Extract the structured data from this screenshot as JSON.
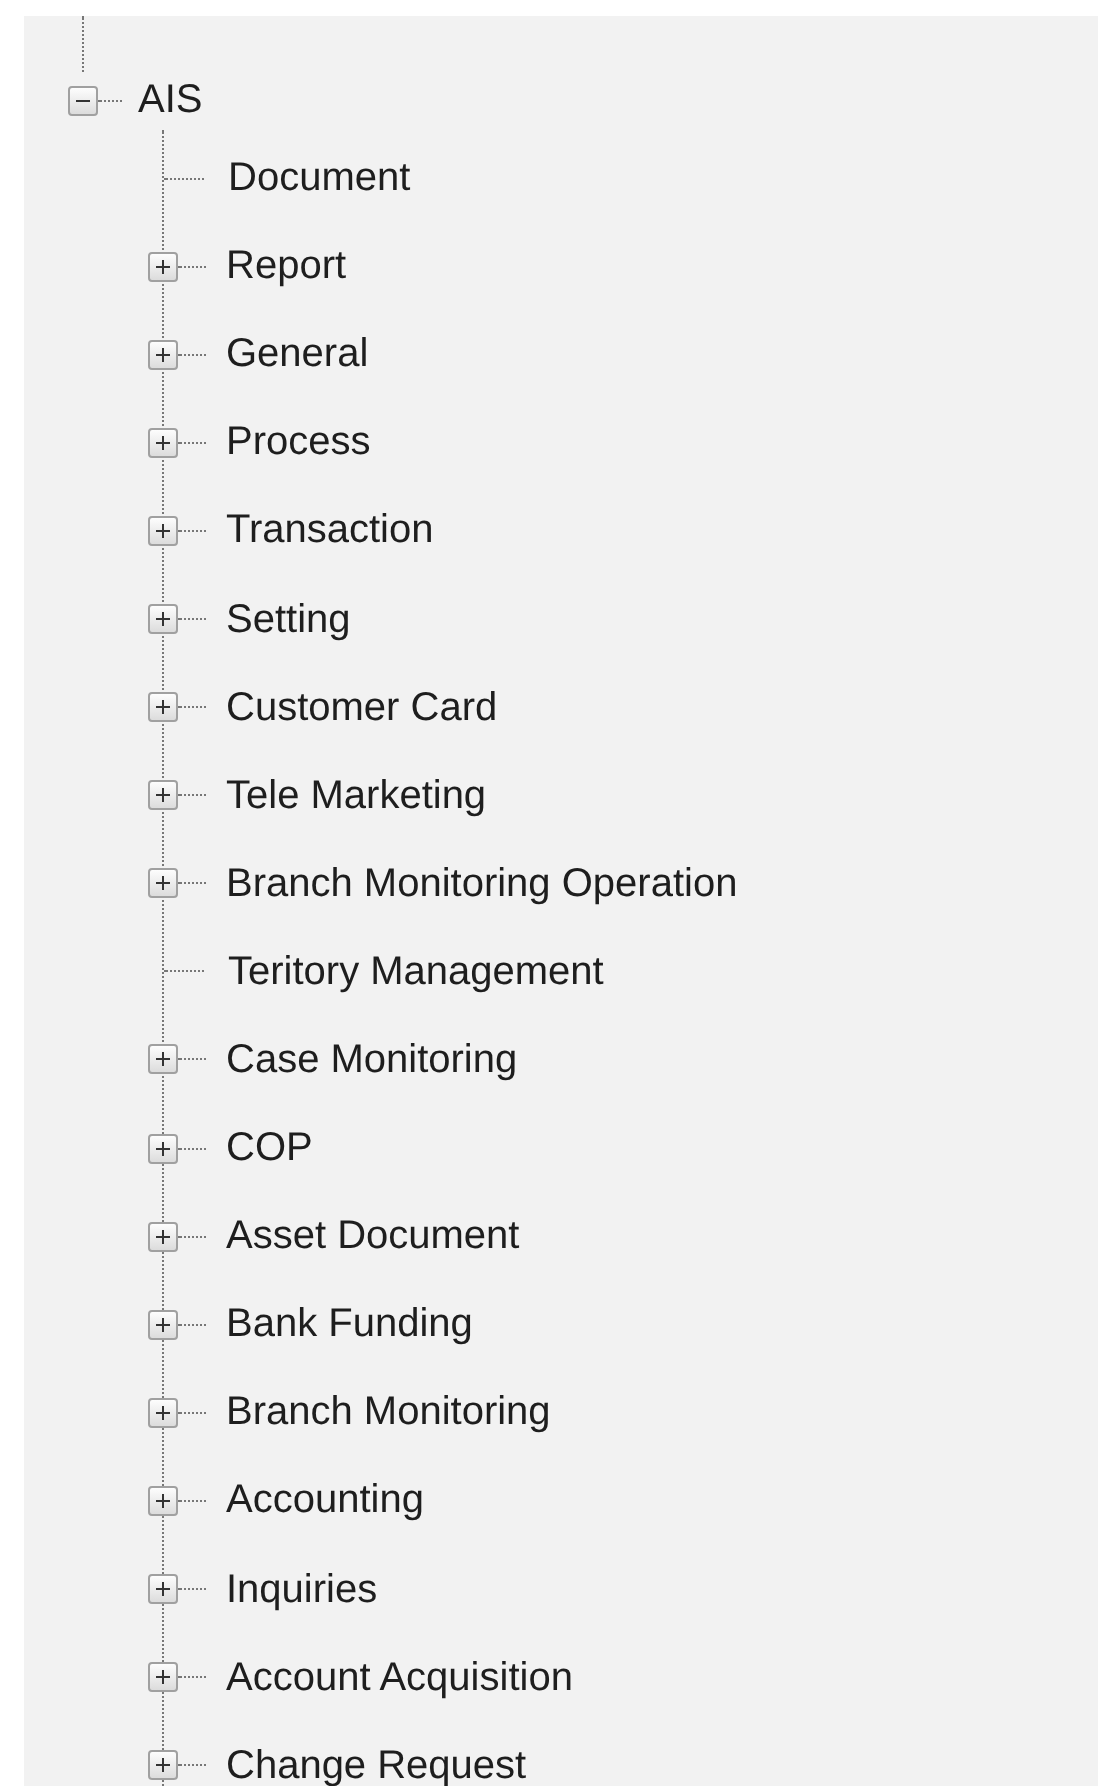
{
  "tree": {
    "label": "AIS",
    "expanded": true,
    "children": [
      {
        "label": "Document",
        "kind": "leaf"
      },
      {
        "label": "Report",
        "kind": "branch",
        "expanded": false
      },
      {
        "label": "General",
        "kind": "branch",
        "expanded": false
      },
      {
        "label": "Process",
        "kind": "branch",
        "expanded": false
      },
      {
        "label": "Transaction",
        "kind": "branch",
        "expanded": false
      },
      {
        "label": "Setting",
        "kind": "branch",
        "expanded": false
      },
      {
        "label": "Customer Card",
        "kind": "branch",
        "expanded": false
      },
      {
        "label": "Tele Marketing",
        "kind": "branch",
        "expanded": false
      },
      {
        "label": "Branch Monitoring Operation",
        "kind": "branch",
        "expanded": false
      },
      {
        "label": "Teritory Management",
        "kind": "leaf"
      },
      {
        "label": "Case Monitoring",
        "kind": "branch",
        "expanded": false
      },
      {
        "label": "COP",
        "kind": "branch",
        "expanded": false
      },
      {
        "label": "Asset Document",
        "kind": "branch",
        "expanded": false
      },
      {
        "label": "Bank Funding",
        "kind": "branch",
        "expanded": false
      },
      {
        "label": "Branch Monitoring",
        "kind": "branch",
        "expanded": false
      },
      {
        "label": "Accounting",
        "kind": "branch",
        "expanded": false
      },
      {
        "label": "Inquiries",
        "kind": "branch",
        "expanded": false
      },
      {
        "label": "Account Acquisition",
        "kind": "branch",
        "expanded": false
      },
      {
        "label": "Change Request",
        "kind": "branch",
        "expanded": false
      }
    ]
  }
}
